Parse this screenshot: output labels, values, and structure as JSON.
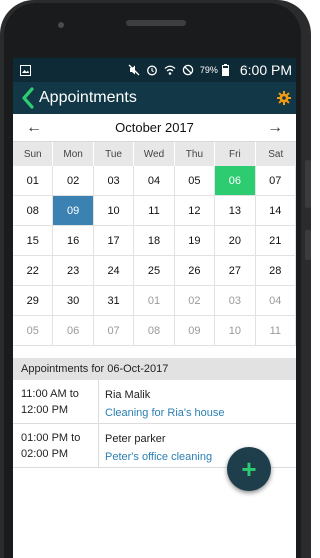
{
  "status_bar": {
    "battery": "79%",
    "time": "6:00 PM"
  },
  "app_bar": {
    "title": "Appointments"
  },
  "calendar": {
    "month_title": "October 2017",
    "prev": "←",
    "next": "→",
    "days_of_week": [
      "Sun",
      "Mon",
      "Tue",
      "Wed",
      "Thu",
      "Fri",
      "Sat"
    ],
    "cells": [
      [
        "01",
        "02",
        "03",
        "04",
        "05",
        "06",
        "07"
      ],
      [
        "08",
        "09",
        "10",
        "11",
        "12",
        "13",
        "14"
      ],
      [
        "15",
        "16",
        "17",
        "18",
        "19",
        "20",
        "21"
      ],
      [
        "22",
        "23",
        "24",
        "25",
        "26",
        "27",
        "28"
      ],
      [
        "29",
        "30",
        "31",
        "01",
        "02",
        "03",
        "04"
      ],
      [
        "05",
        "06",
        "07",
        "08",
        "09",
        "10",
        "11"
      ]
    ]
  },
  "appointments": {
    "header": "Appointments for 06-Oct-2017",
    "items": [
      {
        "time": "11:00 AM to 12:00 PM",
        "name": "Ria Malik",
        "title": "Cleaning for Ria's house"
      },
      {
        "time": "01:00 PM to 02:00 PM",
        "name": "Peter parker",
        "title": "Peter's office cleaning"
      }
    ]
  },
  "fab": {
    "label": "+"
  },
  "colors": {
    "appbar": "#123746",
    "today": "#2ecc71",
    "selected": "#3b82b3",
    "link": "#2b7fb3",
    "gear": "#f39c12"
  }
}
